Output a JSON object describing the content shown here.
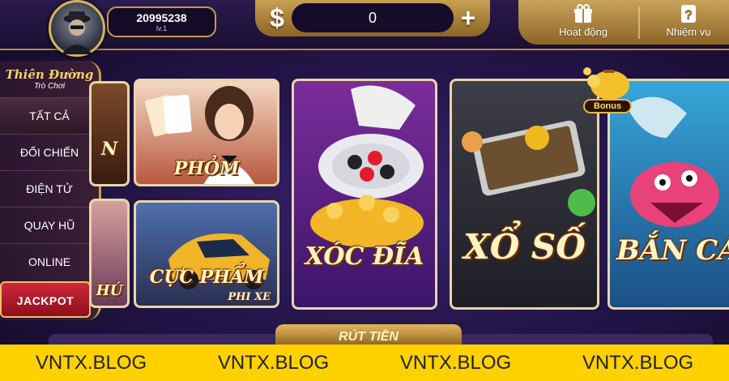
{
  "user": {
    "balance": "20995238",
    "level": "lv.1"
  },
  "wallet": {
    "currency_icon": "dollar-icon",
    "amount": "0",
    "add_icon": "plus-icon"
  },
  "top_actions": [
    {
      "label": "Hoạt động",
      "icon": "gift-icon"
    },
    {
      "label": "Nhiệm vụ",
      "icon": "mission-icon"
    }
  ],
  "sidebar": {
    "logo_line1": "Thiên Đường",
    "logo_line2": "Trò Chơi",
    "items": [
      {
        "label": "TẤT CẢ"
      },
      {
        "label": "ĐỐI CHIẾN"
      },
      {
        "label": "ĐIỆN TỬ"
      },
      {
        "label": "QUAY HŨ"
      },
      {
        "label": "ONLINE"
      },
      {
        "label": "JACKPOT"
      }
    ]
  },
  "games": {
    "phom": "PHỎM",
    "cuc_pham": "CỰC PHẨM",
    "cuc_pham_sub": "PHI XE",
    "xoc_dia": "XÓC ĐĨA",
    "xo_so": "XỔ SỐ",
    "ban_ca": "BẮN CÁ",
    "partial_top": "N",
    "partial_bottom": "HÚ"
  },
  "bonus_label": "Bonus",
  "withdraw_label": "RÚT TIỀN",
  "watermark": [
    "VNTX.BLOG",
    "VNTX.BLOG",
    "VNTX.BLOG",
    "VNTX.BLOG"
  ],
  "colors": {
    "gold": "#c9a04a",
    "watermark_bg": "#ffd100",
    "jackpot_red": "#d0283b"
  }
}
